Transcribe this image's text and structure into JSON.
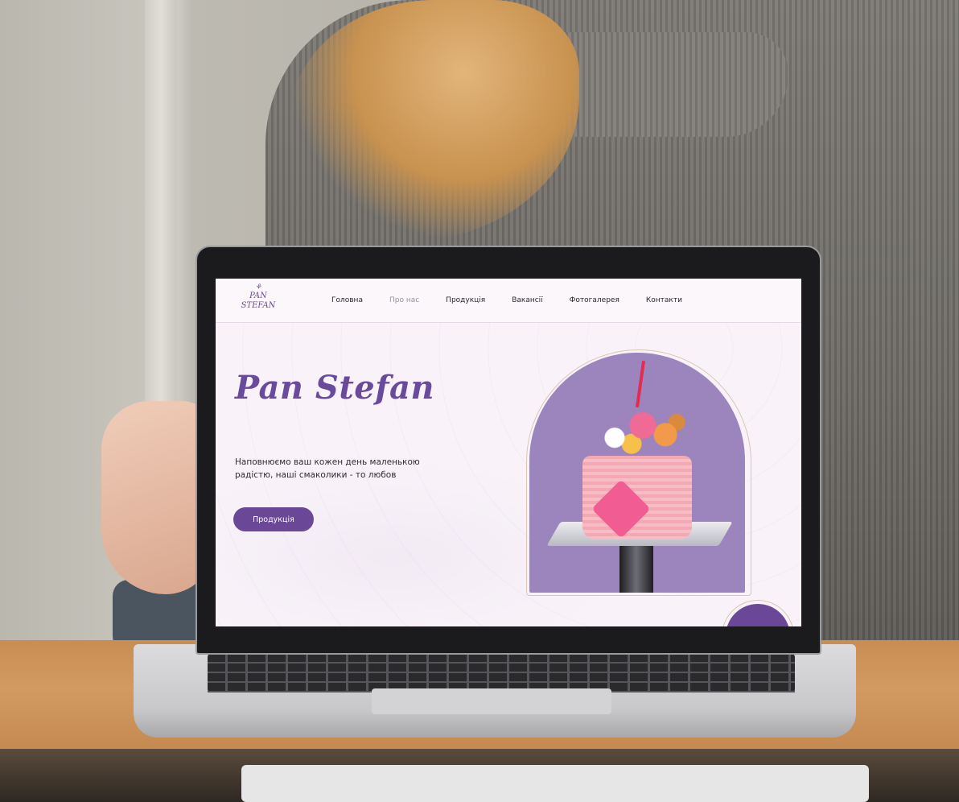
{
  "site": {
    "logo": {
      "line1": "PAN",
      "line2": "STEFAN",
      "mark": "⚘"
    },
    "nav": [
      {
        "label": "Головна"
      },
      {
        "label": "Про нас"
      },
      {
        "label": "Продукція"
      },
      {
        "label": "Вакансії"
      },
      {
        "label": "Фотогалерея"
      },
      {
        "label": "Контакти"
      }
    ],
    "hero": {
      "title": "Pan Stefan",
      "text": "Наповнюємо ваш кожен день маленькою радістю, наші смаколики - то любов",
      "button": "Продукція"
    }
  },
  "colors": {
    "accent": "#6a4797",
    "title": "#6a4a9c",
    "arch": "#9c84bd",
    "screen_bg": "#f9f3f9"
  }
}
